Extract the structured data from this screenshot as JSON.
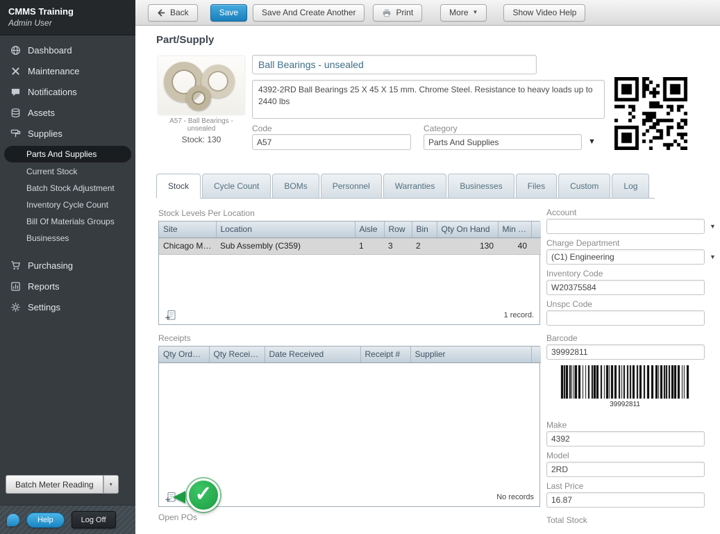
{
  "app": {
    "title": "CMMS Training",
    "user": "Admin User"
  },
  "toolbar": {
    "back": "Back",
    "save": "Save",
    "save_and_create": "Save And Create Another",
    "print": "Print",
    "more": "More",
    "show_video_help": "Show Video Help"
  },
  "sidebar": {
    "items": [
      {
        "label": "Dashboard",
        "icon": "dashboard-icon"
      },
      {
        "label": "Maintenance",
        "icon": "maintenance-icon"
      },
      {
        "label": "Notifications",
        "icon": "notifications-icon"
      },
      {
        "label": "Assets",
        "icon": "assets-icon"
      },
      {
        "label": "Supplies",
        "icon": "supplies-icon"
      }
    ],
    "supplies_subitems": [
      {
        "label": "Parts And Supplies",
        "selected": true
      },
      {
        "label": "Current Stock",
        "selected": false
      },
      {
        "label": "Batch Stock Adjustment",
        "selected": false
      },
      {
        "label": "Inventory Cycle Count",
        "selected": false
      },
      {
        "label": "Bill Of Materials Groups",
        "selected": false
      },
      {
        "label": "Businesses",
        "selected": false
      }
    ],
    "lower_items": [
      {
        "label": "Purchasing",
        "icon": "purchasing-icon"
      },
      {
        "label": "Reports",
        "icon": "reports-icon"
      },
      {
        "label": "Settings",
        "icon": "settings-icon"
      }
    ],
    "batch_meter_reading": "Batch Meter Reading",
    "help": "Help",
    "log_off": "Log Off"
  },
  "page": {
    "title": "Part/Supply"
  },
  "part": {
    "name": "Ball Bearings - unsealed",
    "description": "4392-2RD Ball Bearings 25 X 45 X 15 mm. Chrome Steel. Resistance to heavy loads up to 2440 lbs",
    "image_caption": "A57 - Ball Bearings - unsealed",
    "stock_label": "Stock: 130",
    "code_label": "Code",
    "code": "A57",
    "category_label": "Category",
    "category": "Parts And Supplies"
  },
  "tabs": [
    {
      "label": "Stock",
      "active": true
    },
    {
      "label": "Cycle Count",
      "active": false
    },
    {
      "label": "BOMs",
      "active": false
    },
    {
      "label": "Personnel",
      "active": false
    },
    {
      "label": "Warranties",
      "active": false
    },
    {
      "label": "Businesses",
      "active": false
    },
    {
      "label": "Files",
      "active": false
    },
    {
      "label": "Custom",
      "active": false
    },
    {
      "label": "Log",
      "active": false
    }
  ],
  "stock_levels": {
    "title": "Stock Levels Per Location",
    "headers": [
      "Site",
      "Location",
      "Aisle",
      "Row",
      "Bin",
      "Qty On Hand",
      "Min Qty"
    ],
    "rows": [
      {
        "site": "Chicago Ma...",
        "location": "Sub Assembly (C359)",
        "aisle": "1",
        "row": "3",
        "bin": "2",
        "qty_on_hand": "130",
        "min_qty": "40"
      }
    ],
    "record_count": "1 record."
  },
  "receipts": {
    "title": "Receipts",
    "headers": [
      "Qty Ordered",
      "Qty Received",
      "Date Received",
      "Receipt #",
      "Supplier"
    ],
    "record_count": "No records"
  },
  "open_pos": {
    "title": "Open POs"
  },
  "details": {
    "account_label": "Account",
    "account_value": "",
    "charge_department_label": "Charge Department",
    "charge_department_value": "(C1) Engineering",
    "inventory_code_label": "Inventory Code",
    "inventory_code_value": "W20375584",
    "unspc_code_label": "Unspc Code",
    "unspc_code_value": "",
    "barcode_label": "Barcode",
    "barcode_value": "39992811",
    "barcode_caption": "39992811",
    "make_label": "Make",
    "make_value": "4392",
    "model_label": "Model",
    "model_value": "2RD",
    "last_price_label": "Last Price",
    "last_price_value": "16.87",
    "total_stock_label": "Total Stock"
  },
  "icons": {
    "chevron_down": "▼",
    "chevron_down_small": "▾",
    "check_glyph": "✓",
    "back_arrow": "arrow-left-icon",
    "print": "printer-icon",
    "add_record": "add-record-icon"
  },
  "colors": {
    "accent_blue": "#1b7fba",
    "success_green": "#1e9e44",
    "sidebar_bg": "#373c41",
    "table_header": "#c2cfda"
  }
}
